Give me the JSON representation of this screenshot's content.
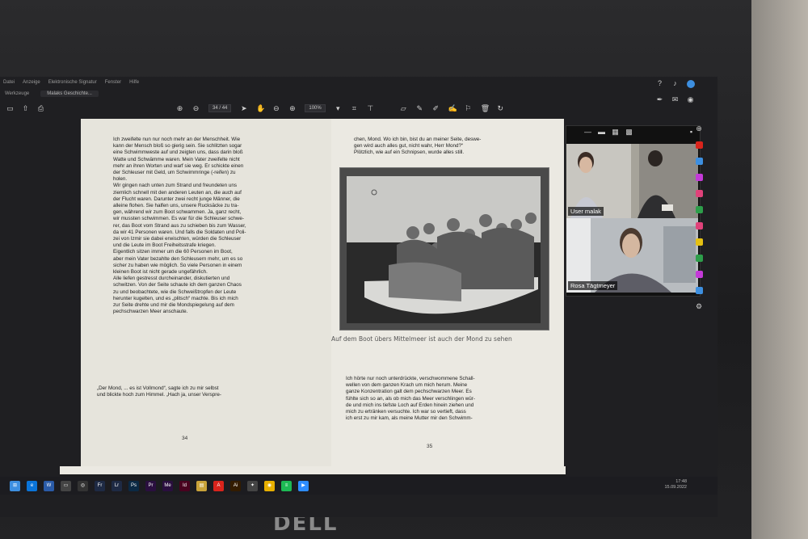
{
  "menubar": {
    "items": [
      "Datei",
      "Anzeige",
      "Elektronische Signatur",
      "Fenster",
      "Hilfe"
    ]
  },
  "tabs": {
    "items": [
      "Werkzeuge",
      "Malaks Geschichte..."
    ]
  },
  "toolbar": {
    "current_page": "34",
    "page_total": "/ 44",
    "zoom": "100%"
  },
  "document": {
    "left_page": {
      "text_top": "Ich zweifelte nun nur noch mehr an der Menschheit. Wie\nkann der Mensch bloß so gierig sein. Sie schlitzten sogar\neine Schwimmweste auf und zeigten uns, dass darin bloß\nWatte und Schwämme waren. Mein Vater zweifelte nicht\nmehr an ihren Worten und warf sie weg. Er schickte einen\nder Schleuser mit Geld, um Schwimmringe (-reifen) zu\nholen.\nWir gingen nach unten zum Strand und freundeten uns\nziemlich schnell mit den anderen Leuten an, die auch auf\nder Flucht waren. Darunter zwei recht junge Männer, die\nalleine flohen. Sie halfen uns, unsere Rucksäcke zu tra-\ngen, während wir zum Boot schwammen. Ja, ganz recht,\nwir mussten schwimmen. Es war für die Schleuser schwe-\nrer, das Boot vom Strand aus zu schieben bis zum Wasser,\nda wir 41 Personen waren. Und falls die Soldaten und Poli-\nzei von Izmir sie dabei erwischten, würden die Schleuser\nund die Leute im Boot Freiheitsstrafe kriegen.\nEigentlich sitzen immer um die 60 Personen im Boot,\naber mein Vater bezahlte den Schleusern mehr, um es so\nsicher zu haben wie möglich. So viele Personen in einem\nkleinen Boot ist nicht gerade ungefährlich.\nAlle liefen gestresst durcheinander, diskutierten und\nschwitzen. Von der Seite schaute ich dem ganzen Chaos\nzu und beobachtete, wie die Schweißtropfen der Leute\nherunter kugelten, und es „plitsch“ machte. Bis ich mich\nzur Seite drehte und mir die Mondspiegelung auf dem\npechschwarzen Meer anschaute.",
      "text_bottom": "„Der Mond, ... es ist Vollmond“, sagte ich zu mir selbst\nund blickte hoch zum Himmel. „Hach ja, unser Verspre-",
      "page_number": "34"
    },
    "right_page": {
      "text_top": "chen, Mond. Wo ich bin, bist du an meiner Seite, deswe-\ngen wird auch alles gut, nicht wahr, Herr Mond?“\nPlötzlich, wie auf ein Schnipsen, wurde alles still.",
      "caption": "Auf dem Boot übers Mittelmeer ist auch der Mond zu sehen",
      "text_bottom": "Ich hörte nur noch unterdrückte, verschwommene Schall-\nwellen von dem ganzen Krach um mich herum. Meine\nganze Konzentration galt dem pechschwarzen Meer. Es\nfühlte sich so an, als ob mich das Meer verschlingen wür-\nde und mich ins tiefste Loch auf Erden hinein ziehen und\nmich zu ertränken versuchte.  Ich war so vertieft, dass\nich erst zu mir kam, als meine Mutter mir den Schwimm-",
      "page_number": "35"
    }
  },
  "call": {
    "participants": [
      {
        "name": "User malak"
      },
      {
        "name": "Rosa Tägtmeyer"
      }
    ]
  },
  "taskbar": {
    "apps": [
      "Fr",
      "Lr",
      "Ps",
      "Pr",
      "Me",
      "Id",
      "Ai"
    ],
    "time": "17:48",
    "date": "15.09.2022"
  },
  "laptop": {
    "brand": "DELL"
  },
  "colors": {
    "accent_blue": "#3d8fe0",
    "acrobat_red": "#d9241c",
    "page_bg": "#ebe9e2"
  }
}
